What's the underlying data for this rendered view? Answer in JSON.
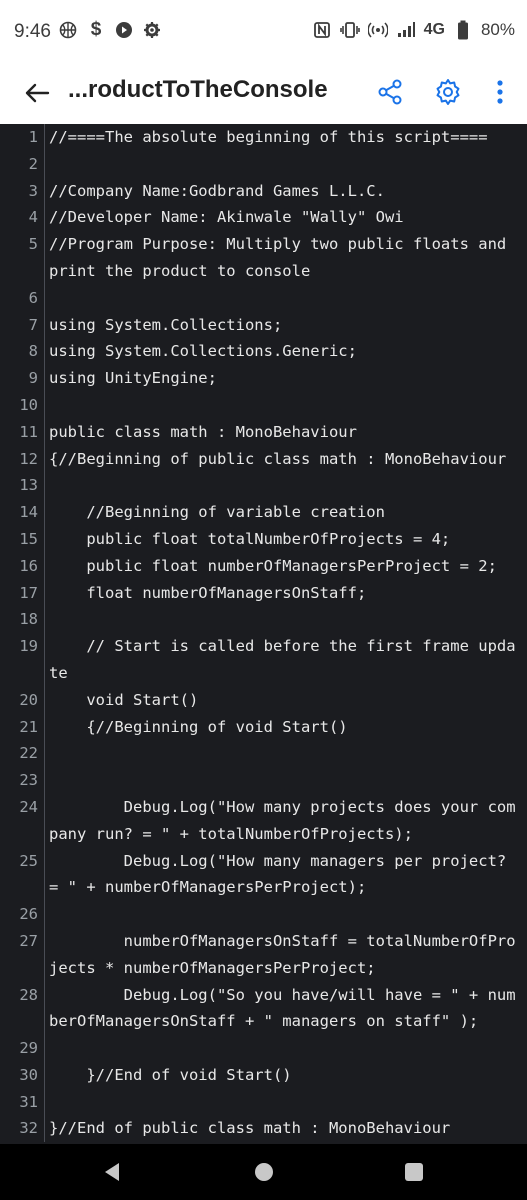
{
  "status": {
    "time": "9:46",
    "left_icons": [
      "basketball-icon",
      "dollar-icon",
      "play-circle-icon",
      "gear-icon"
    ],
    "right_icons": [
      "nfc-icon",
      "vibrate-icon",
      "hotspot-icon",
      "signal-icon"
    ],
    "network": "4G",
    "battery": "80%"
  },
  "appbar": {
    "title": "...roductToTheConsole",
    "back_icon": "arrow-left-icon",
    "actions": [
      "share-icon",
      "settings-icon",
      "more-vert-icon"
    ],
    "accent": "#1a73e8"
  },
  "code": {
    "lines": [
      {
        "n": "1",
        "t": "//====The absolute beginning of this script===="
      },
      {
        "n": "2",
        "t": ""
      },
      {
        "n": "3",
        "t": "//Company Name:Godbrand Games L.L.C."
      },
      {
        "n": "4",
        "t": "//Developer Name: Akinwale \"Wally\" Owi"
      },
      {
        "n": "5",
        "t": "//Program Purpose: Multiply two public floats and print the product to console"
      },
      {
        "n": "6",
        "t": ""
      },
      {
        "n": "7",
        "t": "using System.Collections;"
      },
      {
        "n": "8",
        "t": "using System.Collections.Generic;"
      },
      {
        "n": "9",
        "t": "using UnityEngine;"
      },
      {
        "n": "10",
        "t": ""
      },
      {
        "n": "11",
        "t": "public class math : MonoBehaviour"
      },
      {
        "n": "12",
        "t": "{//Beginning of public class math : MonoBehaviour"
      },
      {
        "n": "13",
        "t": ""
      },
      {
        "n": "14",
        "t": "    //Beginning of variable creation"
      },
      {
        "n": "15",
        "t": "    public float totalNumberOfProjects = 4;"
      },
      {
        "n": "16",
        "t": "    public float numberOfManagersPerProject = 2;"
      },
      {
        "n": "17",
        "t": "    float numberOfManagersOnStaff;"
      },
      {
        "n": "18",
        "t": ""
      },
      {
        "n": "19",
        "t": "    // Start is called before the first frame update"
      },
      {
        "n": "20",
        "t": "    void Start()"
      },
      {
        "n": "21",
        "t": "    {//Beginning of void Start()"
      },
      {
        "n": "22",
        "t": ""
      },
      {
        "n": "23",
        "t": ""
      },
      {
        "n": "24",
        "t": "        Debug.Log(\"How many projects does your company run? = \" + totalNumberOfProjects);"
      },
      {
        "n": "25",
        "t": "        Debug.Log(\"How many managers per project? = \" + numberOfManagersPerProject);"
      },
      {
        "n": "26",
        "t": ""
      },
      {
        "n": "27",
        "t": "        numberOfManagersOnStaff = totalNumberOfProjects * numberOfManagersPerProject;"
      },
      {
        "n": "28",
        "t": "        Debug.Log(\"So you have/will have = \" + numberOfManagersOnStaff + \" managers on staff\" );"
      },
      {
        "n": "29",
        "t": ""
      },
      {
        "n": "30",
        "t": "    }//End of void Start()"
      },
      {
        "n": "31",
        "t": ""
      },
      {
        "n": "32",
        "t": "}//End of public class math : MonoBehaviour"
      }
    ]
  },
  "navbar": {
    "buttons": [
      "back-triangle-icon",
      "home-circle-icon",
      "recents-square-icon"
    ]
  }
}
